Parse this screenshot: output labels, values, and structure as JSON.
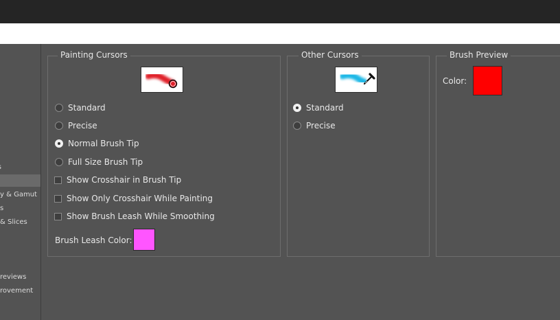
{
  "sidebar": {
    "items": [
      "s",
      "",
      "y & Gamut",
      "s",
      "& Slices",
      "reviews",
      "rovement"
    ]
  },
  "painting_cursors": {
    "title": "Painting Cursors",
    "options": [
      "Standard",
      "Precise",
      "Normal Brush Tip",
      "Full Size Brush Tip"
    ],
    "selected": "Normal Brush Tip",
    "checkboxes": [
      "Show Crosshair in Brush Tip",
      "Show Only Crosshair While Painting",
      "Show Brush Leash While Smoothing"
    ],
    "leash_label": "Brush Leash Color:",
    "leash_color": "#ff55ff"
  },
  "other_cursors": {
    "title": "Other Cursors",
    "options": [
      "Standard",
      "Precise"
    ],
    "selected": "Standard"
  },
  "brush_preview": {
    "title": "Brush Preview",
    "color_label": "Color:",
    "color": "#ff0000"
  }
}
